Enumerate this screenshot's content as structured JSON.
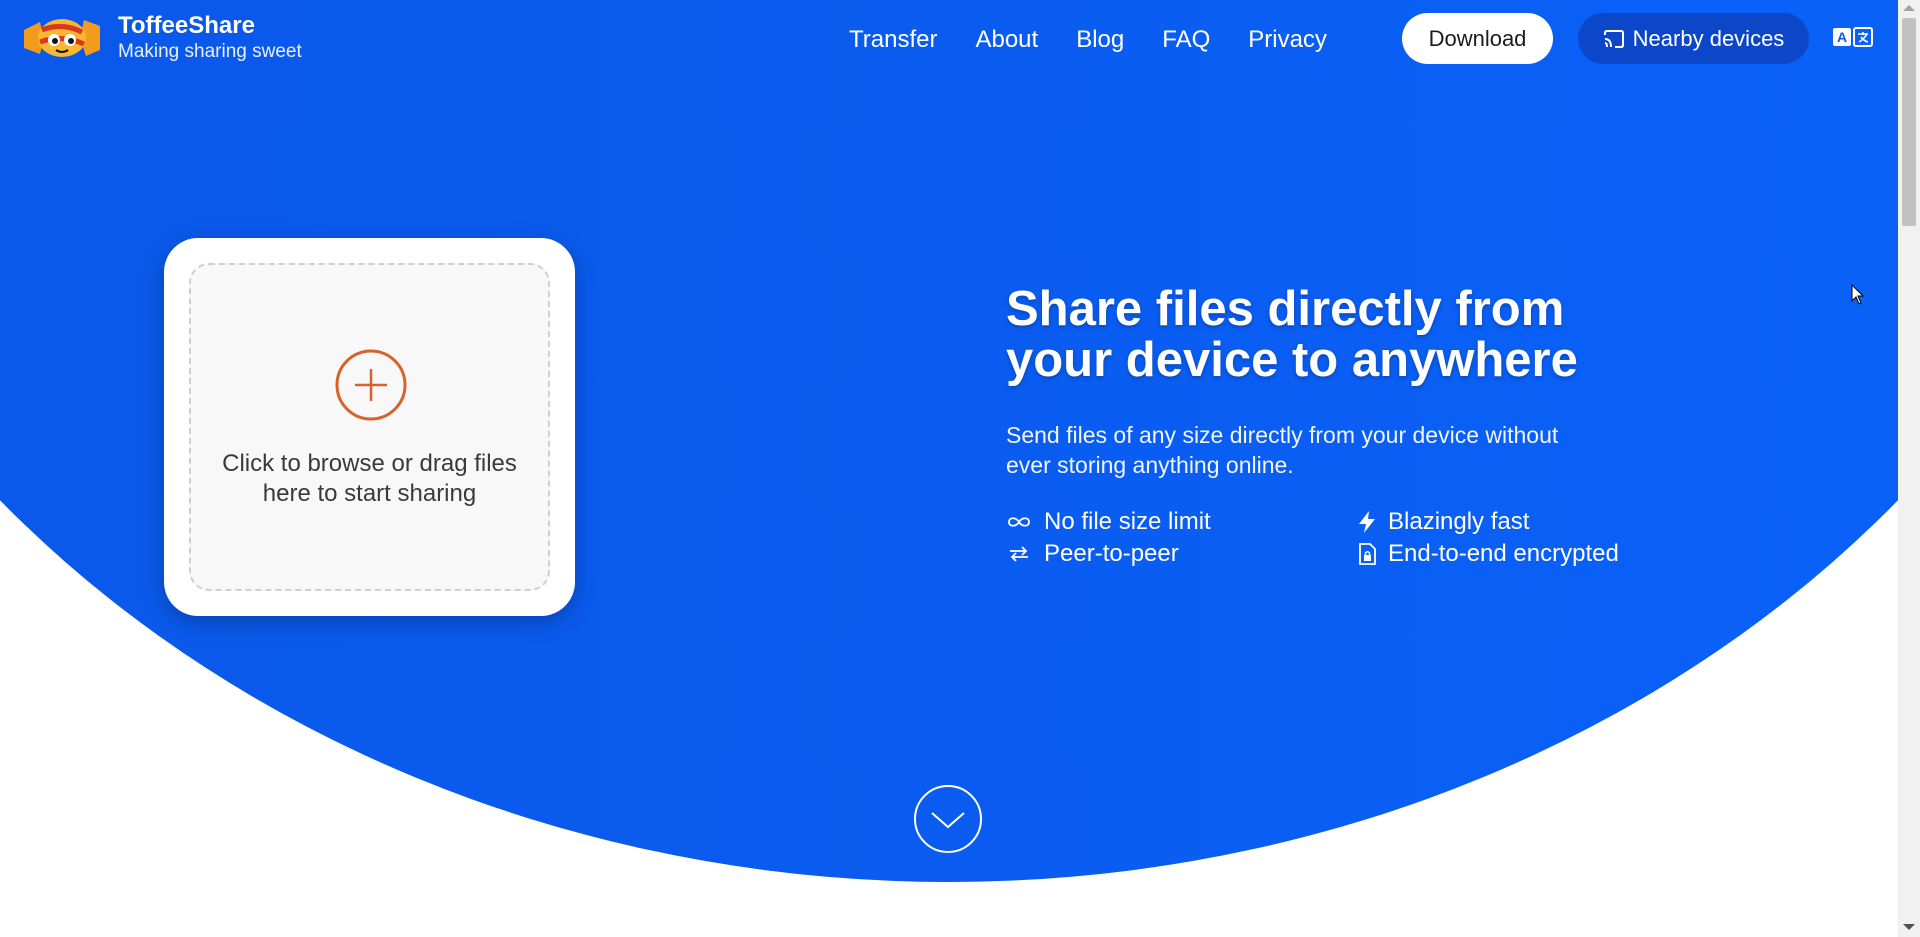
{
  "brand": {
    "name": "ToffeeShare",
    "tagline": "Making sharing sweet"
  },
  "nav": {
    "items": [
      {
        "label": "Transfer"
      },
      {
        "label": "About"
      },
      {
        "label": "Blog"
      },
      {
        "label": "FAQ"
      },
      {
        "label": "Privacy"
      }
    ]
  },
  "header": {
    "download_label": "Download",
    "nearby_label": "Nearby devices",
    "nearby_icon": "cast-icon",
    "language_icon": "translate-icon"
  },
  "upload": {
    "icon": "plus-circle-icon",
    "line1": "Click to browse or drag files",
    "line2": "here to start sharing"
  },
  "hero": {
    "headline_line1": "Share files directly from",
    "headline_line2": "your device to anywhere",
    "subtext_line1": "Send files of any size directly from your device without",
    "subtext_line2": "ever storing anything online."
  },
  "features": [
    {
      "icon": "infinity-icon",
      "label": "No file size limit"
    },
    {
      "icon": "bolt-icon",
      "label": "Blazingly fast"
    },
    {
      "icon": "swap-arrows-icon",
      "label": "Peer-to-peer"
    },
    {
      "icon": "locked-file-icon",
      "label": "End-to-end encrypted"
    }
  ],
  "colors": {
    "hero_blue": "#0a5cf0",
    "nearby_button": "#0d47c9",
    "accent_orange": "#d9622b"
  }
}
